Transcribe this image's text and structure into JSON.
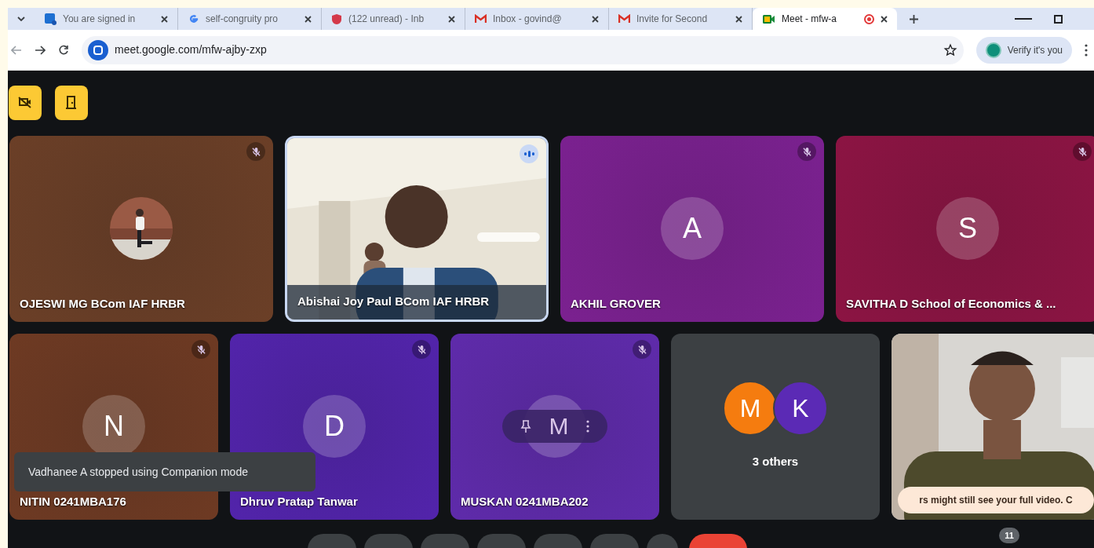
{
  "browser": {
    "tabs": [
      {
        "kind": "skype",
        "title": "You are signed in",
        "selected": false
      },
      {
        "kind": "google",
        "title": "self-congruity pro",
        "selected": false
      },
      {
        "kind": "shield",
        "title": "(122 unread) - Inb",
        "selected": false
      },
      {
        "kind": "gmail",
        "title": "Inbox - govind@",
        "selected": false
      },
      {
        "kind": "gmail",
        "title": "Invite for Second",
        "selected": false
      },
      {
        "kind": "meet",
        "title": "Meet - mfw-a",
        "selected": true,
        "recording": true
      }
    ],
    "url": "meet.google.com/mfw-ajby-zxp",
    "profile_chip": "Verify it's you"
  },
  "meeting": {
    "top_buttons": [
      {
        "kind": "camera_off"
      },
      {
        "kind": "door"
      }
    ],
    "top_row": {
      "tiles": [
        {
          "kind": "avatar_photo",
          "name": "OJESWI MG BCom IAF HRBR",
          "color": "#6b3f27",
          "muted": true
        },
        {
          "kind": "video",
          "name": "Abishai Joy Paul BCom IAF HRBR",
          "speaking": true
        },
        {
          "kind": "avatar",
          "name": "AKHIL GROVER",
          "letter": "A",
          "color": "#7b2190",
          "muted": true
        },
        {
          "kind": "avatar",
          "name": "SAVITHA D School of Economics & ...",
          "letter": "S",
          "color": "#8c1443",
          "muted": true
        }
      ]
    },
    "bottom_row": {
      "tiles": [
        {
          "kind": "avatar",
          "name": "NITIN 0241MBA176",
          "letter": "N",
          "color": "#6e3a23",
          "muted": true
        },
        {
          "kind": "avatar",
          "name": "Dhruv Pratap Tanwar",
          "letter": "D",
          "color": "#5224ab",
          "muted": true
        },
        {
          "kind": "avatar",
          "name": "MUSKAN 0241MBA202",
          "letter": "M",
          "color": "#5f2bab",
          "muted": true,
          "hover_controls": true
        },
        {
          "kind": "others",
          "label": "3 others",
          "avatars": [
            {
              "letter": "M",
              "color": "#f57c0f"
            },
            {
              "letter": "K",
              "color": "#5b2ab5"
            }
          ]
        },
        {
          "kind": "video",
          "notice": "rs might still see your full video. C"
        }
      ]
    },
    "toast": "Vadhanee A stopped using Companion mode",
    "controls": [
      {
        "kind": "normal"
      },
      {
        "kind": "normal"
      },
      {
        "kind": "normal"
      },
      {
        "kind": "normal"
      },
      {
        "kind": "normal"
      },
      {
        "kind": "normal"
      },
      {
        "kind": "small"
      },
      {
        "kind": "leave"
      }
    ],
    "participant_count": "11"
  }
}
